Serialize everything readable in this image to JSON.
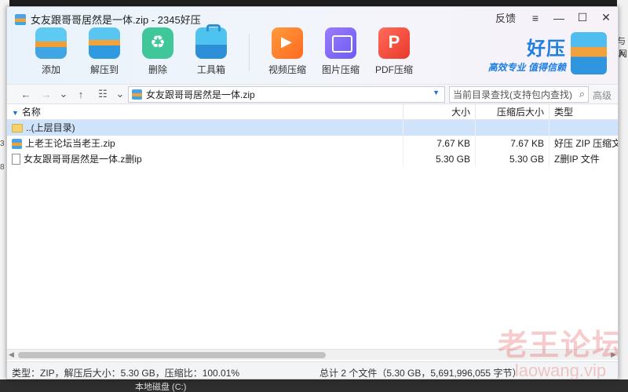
{
  "window": {
    "title": "女友跟哥哥居然是一体.zip - 2345好压",
    "feedback": "反馈",
    "menu_icon": "≡",
    "minimize": "—",
    "maximize": "☐",
    "close": "✕"
  },
  "toolbar": {
    "add": "添加",
    "extract_to": "解压到",
    "delete": "删除",
    "toolbox": "工具箱",
    "video_compress": "视频压缩",
    "image_compress": "图片压缩",
    "pdf_compress": "PDF压缩"
  },
  "brand": {
    "name": "好压",
    "slogan": "高效专业 值得信赖"
  },
  "addressbar": {
    "path": "女友跟哥哥居然是一体.zip",
    "search_placeholder": "当前目录查找(支持包内查找)",
    "advanced": "高级"
  },
  "columns": {
    "name": "名称",
    "size": "大小",
    "compressed_size": "压缩后大小",
    "type": "类型"
  },
  "files": [
    {
      "name": "..(上层目录)",
      "icon": "folder-icon",
      "size": "",
      "csize": "",
      "type": ""
    },
    {
      "name": "上老王论坛当老王.zip",
      "icon": "zip-icon",
      "size": "7.67 KB",
      "csize": "7.67 KB",
      "type": "好压 ZIP 压缩文"
    },
    {
      "name": "女友跟哥哥居然是一体.z删ip",
      "icon": "file-icon",
      "size": "5.30 GB",
      "csize": "5.30 GB",
      "type": "Z删IP 文件"
    }
  ],
  "status": {
    "left": "类型：ZIP，解压后大小：5.30 GB，压缩比：100.01%",
    "right": "总计 2 个文件（5.30 GB，5,691,996,055 字节）"
  },
  "watermark": {
    "title": "老王论坛",
    "url": "laowang.vip"
  },
  "background": {
    "drive_label": "本地磁盘 (C:)",
    "left_frag_1": "3",
    "left_frag_2": "8",
    "right_frag_1": "与入",
    "right_frag_2": "网"
  },
  "colors": {
    "accent": "#1e7fe0",
    "selected_row": "#cfe4fa"
  }
}
